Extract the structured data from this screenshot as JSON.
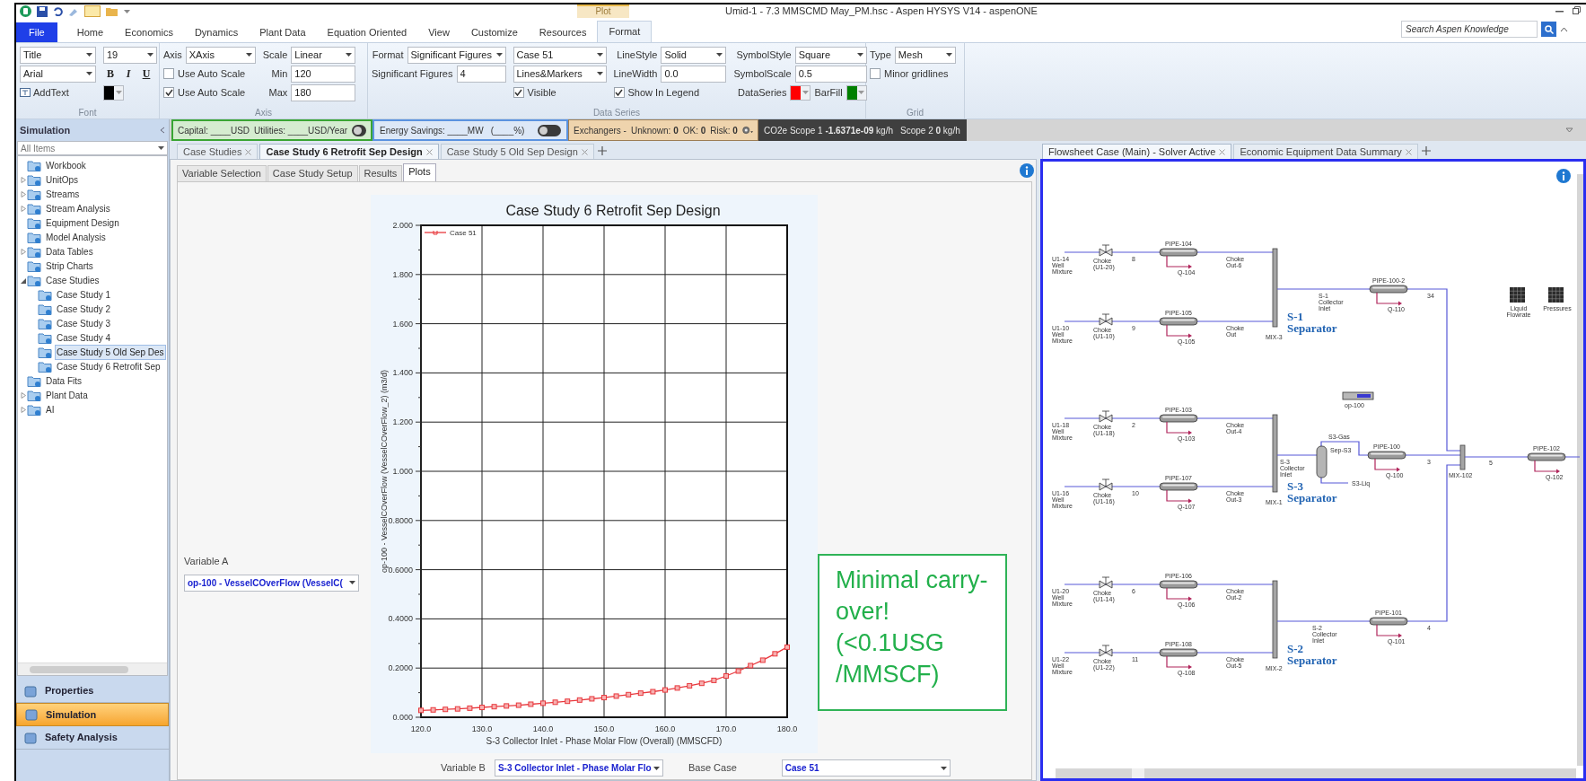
{
  "window": {
    "title": "Umid-1 - 7.3 MMSCMD May_PM.hsc - Aspen HYSYS V14 - aspenONE",
    "contextual_tab": "Plot"
  },
  "ribbon": {
    "tabs": [
      {
        "label": "File",
        "kind": "file",
        "selected": false
      },
      {
        "label": "Home",
        "kind": "tab",
        "selected": false
      },
      {
        "label": "Economics",
        "kind": "tab",
        "selected": false
      },
      {
        "label": "Dynamics",
        "kind": "tab",
        "selected": false
      },
      {
        "label": "Plant Data",
        "kind": "tab",
        "selected": false
      },
      {
        "label": "Equation Oriented",
        "kind": "tab",
        "selected": false
      },
      {
        "label": "View",
        "kind": "tab",
        "selected": false
      },
      {
        "label": "Customize",
        "kind": "tab",
        "selected": false
      },
      {
        "label": "Resources",
        "kind": "tab",
        "selected": false
      },
      {
        "label": "Format",
        "kind": "tab",
        "selected": true
      }
    ],
    "search": {
      "placeholder": "Search Aspen Knowledge"
    },
    "groups": [
      {
        "label": "Font",
        "columns": [
          [
            {
              "kind": "dropdown",
              "value": "Title"
            },
            {
              "kind": "dropdown",
              "value": "Arial"
            },
            {
              "kind": "button",
              "label": "AddText"
            }
          ],
          [
            {
              "kind": "dropdown",
              "value": "19"
            },
            {
              "kind": "styles",
              "labels": [
                "B",
                "I",
                "U"
              ]
            },
            {
              "kind": "color",
              "color": "#000000"
            }
          ]
        ]
      },
      {
        "label": "Axis",
        "columns": [
          [
            {
              "kind": "dropdown",
              "label": "Axis",
              "value": "XAxis"
            },
            {
              "kind": "checkbox",
              "label": "Use Auto Scale",
              "checked": false
            },
            {
              "kind": "checkbox",
              "label": "Use Auto Scale",
              "checked": true
            }
          ],
          [
            {
              "kind": "dropdown",
              "label": "Scale",
              "value": "Linear"
            },
            {
              "kind": "field",
              "label": "Min",
              "value": "120"
            },
            {
              "kind": "field",
              "label": "Max",
              "value": "180"
            }
          ]
        ]
      },
      {
        "label": "Data Series",
        "columns": [
          [
            {
              "kind": "dropdown",
              "label": "Format",
              "value": "Significant Figures"
            },
            {
              "kind": "field",
              "label": "Significant Figures",
              "value": "4"
            }
          ],
          [
            {
              "kind": "dropdown",
              "value": "Case 51"
            },
            {
              "kind": "dropdown",
              "value": "Lines&Markers"
            },
            {
              "kind": "checkbox",
              "label": "Visible",
              "checked": true
            }
          ],
          [
            {
              "kind": "dropdown",
              "label": "LineStyle",
              "value": "Solid"
            },
            {
              "kind": "field",
              "label": "LineWidth",
              "value": "0.0"
            },
            {
              "kind": "checkbox",
              "label": "Show In Legend",
              "checked": true
            }
          ],
          [
            {
              "kind": "dropdown",
              "label": "SymbolStyle",
              "value": "Square"
            },
            {
              "kind": "field",
              "label": "SymbolScale",
              "value": "0.5"
            },
            [
              {
                "kind": "color",
                "label": "DataSeries",
                "color": "#ff0000"
              },
              {
                "kind": "color",
                "label": "BarFill",
                "color": "#008000"
              }
            ]
          ]
        ]
      },
      {
        "label": "Grid",
        "columns": [
          [
            {
              "kind": "dropdown",
              "label": "Type",
              "value": "Mesh"
            },
            {
              "kind": "checkbox",
              "label": "Minor gridlines",
              "checked": false
            }
          ]
        ]
      }
    ]
  },
  "status_strip": {
    "capital": "Capital: ____USD",
    "utilities": "Utilities: ____USD/Year",
    "cost_toggle_on": false,
    "energy": "Energy Savings: ____MW",
    "energy_percent": "(____%)",
    "energy_toggle_on": false,
    "exchangers": "Exchangers -",
    "unknown": "Unknown: **0**",
    "ok": "OK: **0**",
    "risk": "Risk: **0**",
    "scope1": "CO2e Scope 1 **-1.6371e-09** kg/h",
    "scope2": "Scope 2 **0** kg/h"
  },
  "sidebar": {
    "title": "Simulation",
    "filter": "All Items",
    "items": [
      {
        "label": "Workbook",
        "selected": false
      },
      {
        "label": "UnitOps",
        "selected": false,
        "expanded": false
      },
      {
        "label": "Streams",
        "selected": false,
        "expanded": false
      },
      {
        "label": "Stream Analysis",
        "selected": false,
        "expanded": false
      },
      {
        "label": "Equipment Design",
        "selected": false
      },
      {
        "label": "Model Analysis",
        "selected": false
      },
      {
        "label": "Data Tables",
        "selected": false,
        "expanded": false
      },
      {
        "label": "Strip Charts",
        "selected": false
      },
      {
        "label": "Case Studies",
        "selected": false,
        "expanded": true,
        "children": [
          {
            "label": "Case Study 1",
            "selected": false
          },
          {
            "label": "Case Study 2",
            "selected": false
          },
          {
            "label": "Case Study 3",
            "selected": false
          },
          {
            "label": "Case Study 4",
            "selected": false
          },
          {
            "label": "Case Study 5 Old Sep Des",
            "selected": true
          },
          {
            "label": "Case Study 6 Retrofit Sep",
            "selected": false
          }
        ]
      },
      {
        "label": "Data Fits",
        "selected": false
      },
      {
        "label": "Plant Data",
        "selected": false,
        "expanded": false
      },
      {
        "label": "AI",
        "selected": false,
        "expanded": false
      }
    ],
    "nav": [
      {
        "label": "Properties",
        "selected": false
      },
      {
        "label": "Simulation",
        "selected": true
      },
      {
        "label": "Safety Analysis",
        "selected": false
      }
    ]
  },
  "document_tabs": [
    {
      "label": "Case Studies",
      "selected": false
    },
    {
      "label": "Case Study 6 Retrofit Sep Design",
      "selected": true
    },
    {
      "label": "Case Study 5 Old Sep Design",
      "selected": false
    }
  ],
  "case_study": {
    "tabs": [
      {
        "label": "Variable Selection",
        "selected": false
      },
      {
        "label": "Case Study Setup",
        "selected": false
      },
      {
        "label": "Results",
        "selected": false
      },
      {
        "label": "Plots",
        "selected": true
      }
    ],
    "variable_a": {
      "label": "Variable A",
      "value": "op-100 - VesselCOverFlow (VesselC("
    },
    "variable_b": {
      "label": "Variable B",
      "value": "S-3 Collector Inlet - Phase Molar Flo"
    },
    "base_case": {
      "label": "Base Case",
      "value": "Case 51"
    },
    "chart_data": {
      "type": "line",
      "title": "Case Study 6 Retrofit Sep Design",
      "xlabel": "S-3 Collector Inlet - Phase Molar Flow (Overall) (MMSCFD)",
      "ylabel": "op-100 - VesselCOverFlow (VesselCOverFlow_2) (m3/d)",
      "x": [
        120,
        122,
        124,
        126,
        128,
        130,
        132,
        134,
        136,
        138,
        140,
        142,
        144,
        146,
        148,
        150,
        152,
        154,
        156,
        158,
        160,
        162,
        164,
        166,
        168,
        170,
        172,
        174,
        176,
        178,
        180
      ],
      "series": [
        {
          "name": "Case 51",
          "color": "#e8383d",
          "values": [
            0.028,
            0.03,
            0.032,
            0.034,
            0.037,
            0.04,
            0.043,
            0.046,
            0.049,
            0.053,
            0.057,
            0.061,
            0.065,
            0.07,
            0.075,
            0.08,
            0.086,
            0.092,
            0.098,
            0.104,
            0.111,
            0.119,
            0.128,
            0.138,
            0.15,
            0.168,
            0.188,
            0.21,
            0.232,
            0.258,
            0.285
          ]
        }
      ],
      "xlim": [
        120,
        180
      ],
      "ylim": [
        0,
        2
      ],
      "grid": true,
      "marker": "square",
      "xticks": [
        {
          "value": 120,
          "label": "120.0"
        },
        {
          "value": 130,
          "label": "130.0"
        },
        {
          "value": 140,
          "label": "140.0"
        },
        {
          "value": 150,
          "label": "150.0"
        },
        {
          "value": 160,
          "label": "160.0"
        },
        {
          "value": 170,
          "label": "170.0"
        },
        {
          "value": 180,
          "label": "180.0"
        }
      ],
      "yticks": [
        {
          "value": 0,
          "label": "0.000"
        },
        {
          "value": 0.2,
          "label": "0.2000"
        },
        {
          "value": 0.4,
          "label": "0.4000"
        },
        {
          "value": 0.6,
          "label": "0.6000"
        },
        {
          "value": 0.8,
          "label": "0.8000"
        },
        {
          "value": 1,
          "label": "1.000"
        },
        {
          "value": 1.2,
          "label": "1.200"
        },
        {
          "value": 1.4,
          "label": "1.400"
        },
        {
          "value": 1.6,
          "label": "1.600"
        },
        {
          "value": 1.8,
          "label": "1.800"
        },
        {
          "value": 2,
          "label": "2.000"
        }
      ]
    },
    "callout": "Minimal carry-over! (<0.1USG /MMSCF)"
  },
  "flowsheet_tabs": [
    {
      "label": "Flowsheet Case (Main) - Solver Active",
      "selected": true
    },
    {
      "label": "Economic Equipment Data Summary",
      "selected": false
    }
  ],
  "flowsheet": {
    "wells": [
      {
        "feed": "U1-14 Well Mixture",
        "choke": "Choke (U1-20)",
        "stream": "8",
        "pipe": "PIPE-104",
        "heat": "Q-104",
        "outlet": "Choke Out-6"
      },
      {
        "feed": "U1-10 Well Mixture",
        "choke": "Choke (U1-10)",
        "stream": "9",
        "pipe": "PIPE-105",
        "heat": "Q-105",
        "outlet": "Choke Out"
      },
      {
        "feed": "U1-18 Well Mixture",
        "choke": "Choke (U1-18)",
        "stream": "2",
        "pipe": "PIPE-103",
        "heat": "Q-103",
        "outlet": "Choke Out-4"
      },
      {
        "feed": "U1-16 Well Mixture",
        "choke": "Choke (U1-16)",
        "stream": "10",
        "pipe": "PIPE-107",
        "heat": "Q-107",
        "outlet": "Choke Out-3"
      },
      {
        "feed": "U1-20 Well Mixture",
        "choke": "Choke (U1-14)",
        "stream": "6",
        "pipe": "PIPE-106",
        "heat": "Q-106",
        "outlet": "Choke Out-2"
      },
      {
        "feed": "U1-22 Well Mixture",
        "choke": "Choke (U1-22)",
        "stream": "11",
        "pipe": "PIPE-108",
        "heat": "Q-108",
        "outlet": "Choke Out-5"
      }
    ],
    "mixers": [
      {
        "name": "MIX-3",
        "separator": "S-1 Separator",
        "inlet": "S-1 Collector Inlet",
        "pipe": "PIPE-100-2",
        "heat": "Q-110",
        "stream": "34"
      },
      {
        "name": "MIX-1",
        "separator": "S-3 Separator",
        "inlet": "S-3 Collector Inlet",
        "pipe": "PIPE-100",
        "heat": "Q-100",
        "stream": "3"
      },
      {
        "name": "MIX-2",
        "separator": "S-2 Separator",
        "inlet": "S-2 Collector Inlet",
        "pipe": "PIPE-101",
        "heat": "Q-101",
        "stream": "4"
      }
    ],
    "vessel": {
      "gas": "S3-Gas",
      "name": "Sep-S3",
      "liquid": "S3-Liq"
    },
    "final_mixer": {
      "name": "MIX-102",
      "stream": "5",
      "pipe": "PIPE-102",
      "heat": "Q-102"
    },
    "spreadsheet": "op-100",
    "tables": [
      "Liquid Flowrate",
      "Pressures"
    ]
  }
}
